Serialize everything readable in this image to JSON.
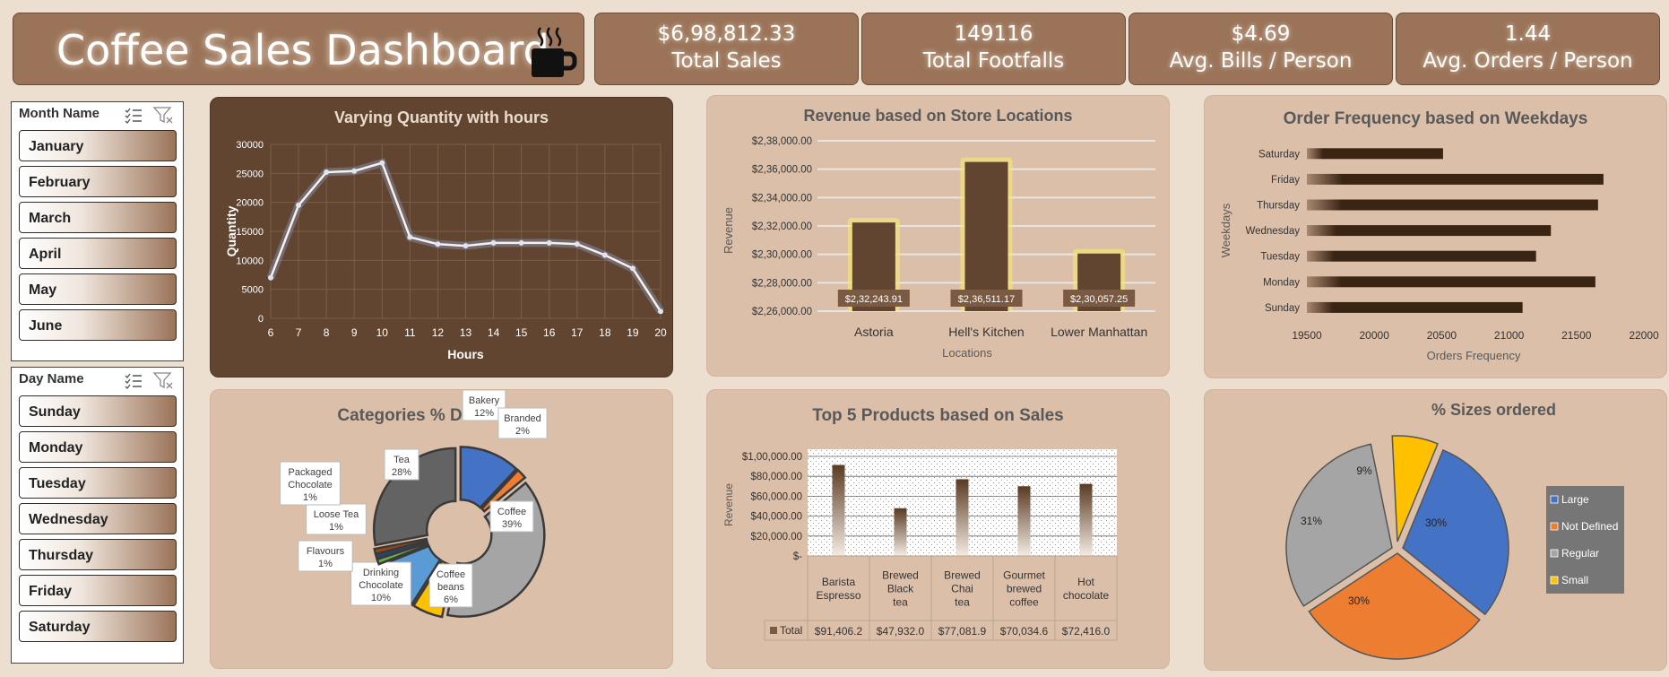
{
  "header": {
    "title": "Coffee Sales Dashboard",
    "icon": "coffee-mug-icon"
  },
  "kpis": [
    {
      "value": "$6,98,812.33",
      "label": "Total Sales"
    },
    {
      "value": "149116",
      "label": "Total Footfalls"
    },
    {
      "value": "$4.69",
      "label": "Avg. Bills / Person"
    },
    {
      "value": "1.44",
      "label": "Avg. Orders / Person"
    }
  ],
  "slicers": {
    "month": {
      "title": "Month Name",
      "items": [
        "January",
        "February",
        "March",
        "April",
        "May",
        "June"
      ]
    },
    "day": {
      "title": "Day Name",
      "items": [
        "Sunday",
        "Monday",
        "Tuesday",
        "Wednesday",
        "Thursday",
        "Friday",
        "Saturday"
      ]
    }
  },
  "colors": {
    "brown": "#614530",
    "panel": "#dbbfa9",
    "kpi": "#9a7358",
    "blue": "#4472c4",
    "orange": "#ed7d31",
    "gray": "#a5a5a5",
    "gold": "#ffc000"
  },
  "chart_data": [
    {
      "type": "line",
      "title": "Varying Quantity with hours",
      "xlabel": "Hours",
      "ylabel": "Quantity",
      "x": [
        6,
        7,
        8,
        9,
        10,
        11,
        12,
        13,
        14,
        15,
        16,
        17,
        18,
        19,
        20
      ],
      "y": [
        7000,
        19500,
        25200,
        25400,
        26800,
        14000,
        12800,
        12500,
        13000,
        13000,
        13000,
        12800,
        10900,
        8600,
        1200
      ],
      "ylim": [
        0,
        30000
      ],
      "yticks": [
        "0",
        "5000",
        "10000",
        "15000",
        "20000",
        "25000",
        "30000"
      ],
      "grid": true
    },
    {
      "type": "bar",
      "title": "Revenue based on Store Locations",
      "xlabel": "Locations",
      "ylabel": "Revenue",
      "categories": [
        "Astoria",
        "Hell's Kitchen",
        "Lower Manhattan"
      ],
      "values": [
        232243.91,
        236511.17,
        230057.25
      ],
      "labels": [
        "$2,32,243.91",
        "$2,36,511.17",
        "$2,30,057.25"
      ],
      "ylim": [
        226000,
        238000
      ],
      "yticks": [
        "$2,26,000.00",
        "$2,28,000.00",
        "$2,30,000.00",
        "$2,32,000.00",
        "$2,34,000.00",
        "$2,36,000.00",
        "$2,38,000.00"
      ]
    },
    {
      "type": "bar",
      "orientation": "horizontal",
      "title": "Order Frequency based on Weekdays",
      "xlabel": "Orders Frequency",
      "ylabel": "Weekdays",
      "categories": [
        "Saturday",
        "Friday",
        "Thursday",
        "Wednesday",
        "Tuesday",
        "Monday",
        "Sunday"
      ],
      "values": [
        20510,
        21700,
        21660,
        21310,
        21200,
        21640,
        21100
      ],
      "xlim": [
        19500,
        22000
      ],
      "xticks": [
        "19500",
        "20000",
        "20500",
        "21000",
        "21500",
        "22000"
      ]
    },
    {
      "type": "pie",
      "title": "Categories % Distribution",
      "categories": [
        "Bakery",
        "Branded",
        "Coffee",
        "Coffee beans",
        "Drinking Chocolate",
        "Flavours",
        "Loose Tea",
        "Packaged Chocolate",
        "Tea"
      ],
      "values": [
        12,
        2,
        39,
        6,
        10,
        1,
        1,
        1,
        28
      ],
      "labels": [
        "12%",
        "2%",
        "39%",
        "6%",
        "10%",
        "1%",
        "1%",
        "1%",
        "28%"
      ]
    },
    {
      "type": "bar",
      "title": "Top 5 Products based on Sales",
      "ylabel": "Revenue",
      "categories": [
        "Barista Espresso",
        "Brewed Black tea",
        "Brewed Chai tea",
        "Gourmet brewed coffee",
        "Hot chocolate"
      ],
      "values": [
        91406.2,
        47932.0,
        77081.9,
        70034.6,
        72416.0
      ],
      "table_row_label": "Total",
      "table_values": [
        "$91,406.2",
        "$47,932.0",
        "$77,081.9",
        "$70,034.6",
        "$72,416.0"
      ],
      "ylim": [
        0,
        100000
      ],
      "yticks": [
        "$-",
        "$20,000.00",
        "$40,000.00",
        "$60,000.00",
        "$80,000.00",
        "$1,00,000.00"
      ]
    },
    {
      "type": "pie",
      "title": "% Sizes ordered",
      "categories": [
        "Large",
        "Not Defined",
        "Regular",
        "Small"
      ],
      "values": [
        30,
        30,
        31,
        9
      ],
      "labels": [
        "30%",
        "30%",
        "31%",
        "9%"
      ],
      "legend": "right"
    }
  ]
}
